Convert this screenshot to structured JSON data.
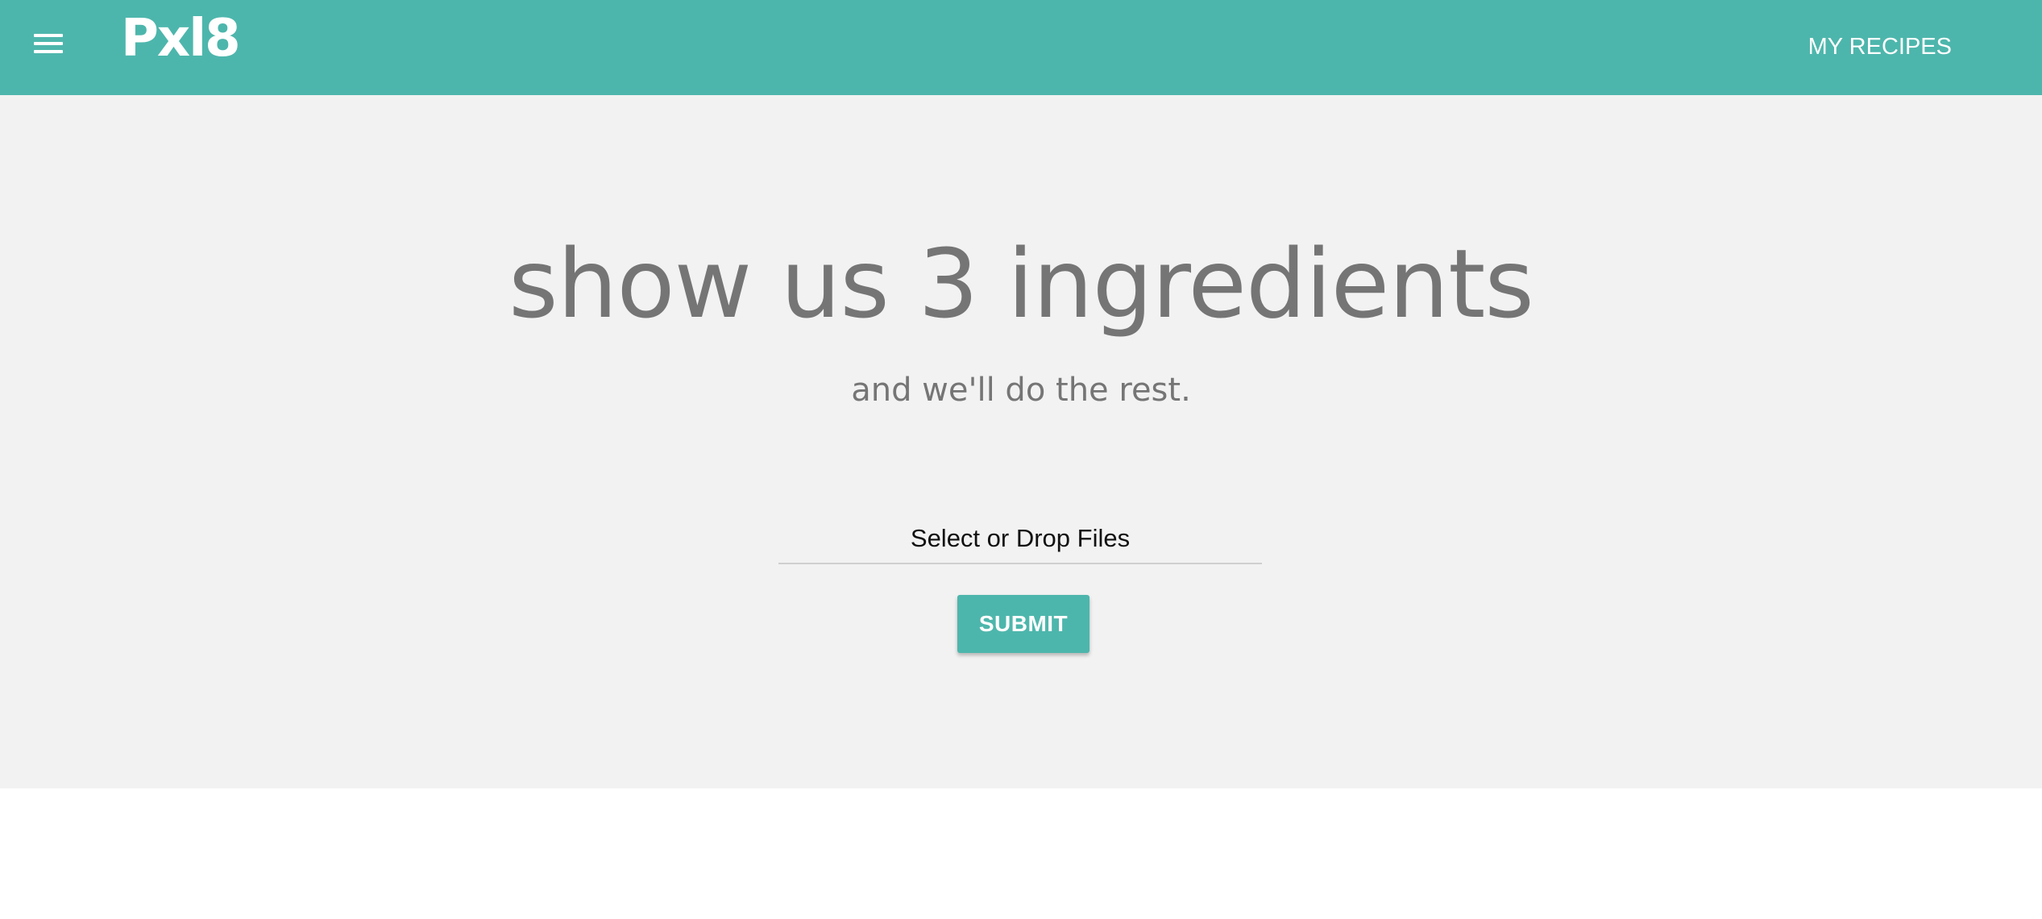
{
  "navbar": {
    "logo": "Pxl8",
    "menu_icon": "hamburger-menu-icon",
    "links": [
      "MY RECIPES"
    ]
  },
  "hero": {
    "headline": "show us 3 ingredients",
    "subheadline": "and we'll do the rest.",
    "file_input_label": "Select or Drop Files",
    "submit_label": "SUBMIT"
  },
  "colors": {
    "accent": "#4db6ac",
    "hero_background": "#f2f2f2",
    "text_muted": "#757575"
  }
}
